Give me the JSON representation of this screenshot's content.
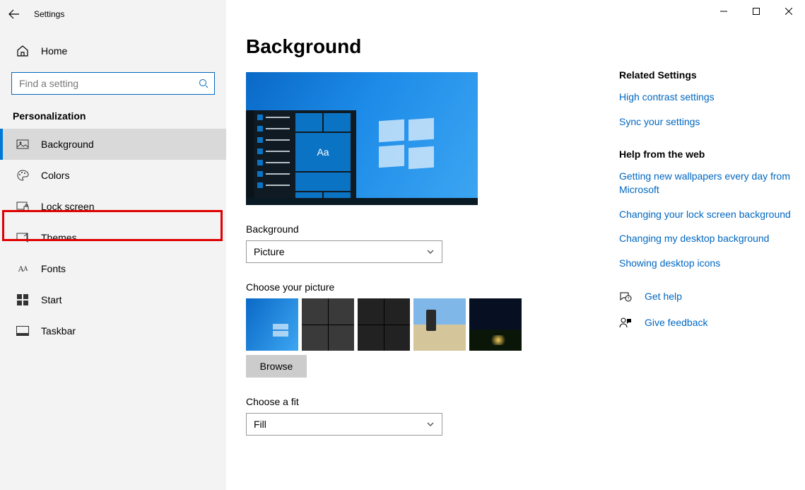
{
  "window": {
    "title": "Settings"
  },
  "sidebar": {
    "home": "Home",
    "search_placeholder": "Find a setting",
    "section": "Personalization",
    "items": [
      {
        "label": "Background",
        "icon": "picture-icon"
      },
      {
        "label": "Colors",
        "icon": "palette-icon"
      },
      {
        "label": "Lock screen",
        "icon": "lockscreen-icon"
      },
      {
        "label": "Themes",
        "icon": "themes-icon"
      },
      {
        "label": "Fonts",
        "icon": "fonts-icon"
      },
      {
        "label": "Start",
        "icon": "start-icon"
      },
      {
        "label": "Taskbar",
        "icon": "taskbar-icon"
      }
    ],
    "active_index": 0,
    "highlighted_index": 2
  },
  "main": {
    "title": "Background",
    "preview_sample_text": "Aa",
    "background_label": "Background",
    "background_value": "Picture",
    "choose_picture_label": "Choose your picture",
    "thumbnails": [
      "windows-default",
      "photo-collage-bw",
      "photo-collage-dark",
      "beach-rocks",
      "night-tent"
    ],
    "browse_label": "Browse",
    "fit_label": "Choose a fit",
    "fit_value": "Fill"
  },
  "rail": {
    "related_heading": "Related Settings",
    "related_links": [
      "High contrast settings",
      "Sync your settings"
    ],
    "help_heading": "Help from the web",
    "help_links": [
      "Getting new wallpapers every day from Microsoft",
      "Changing your lock screen background",
      "Changing my desktop background",
      "Showing desktop icons"
    ],
    "get_help": "Get help",
    "give_feedback": "Give feedback"
  }
}
